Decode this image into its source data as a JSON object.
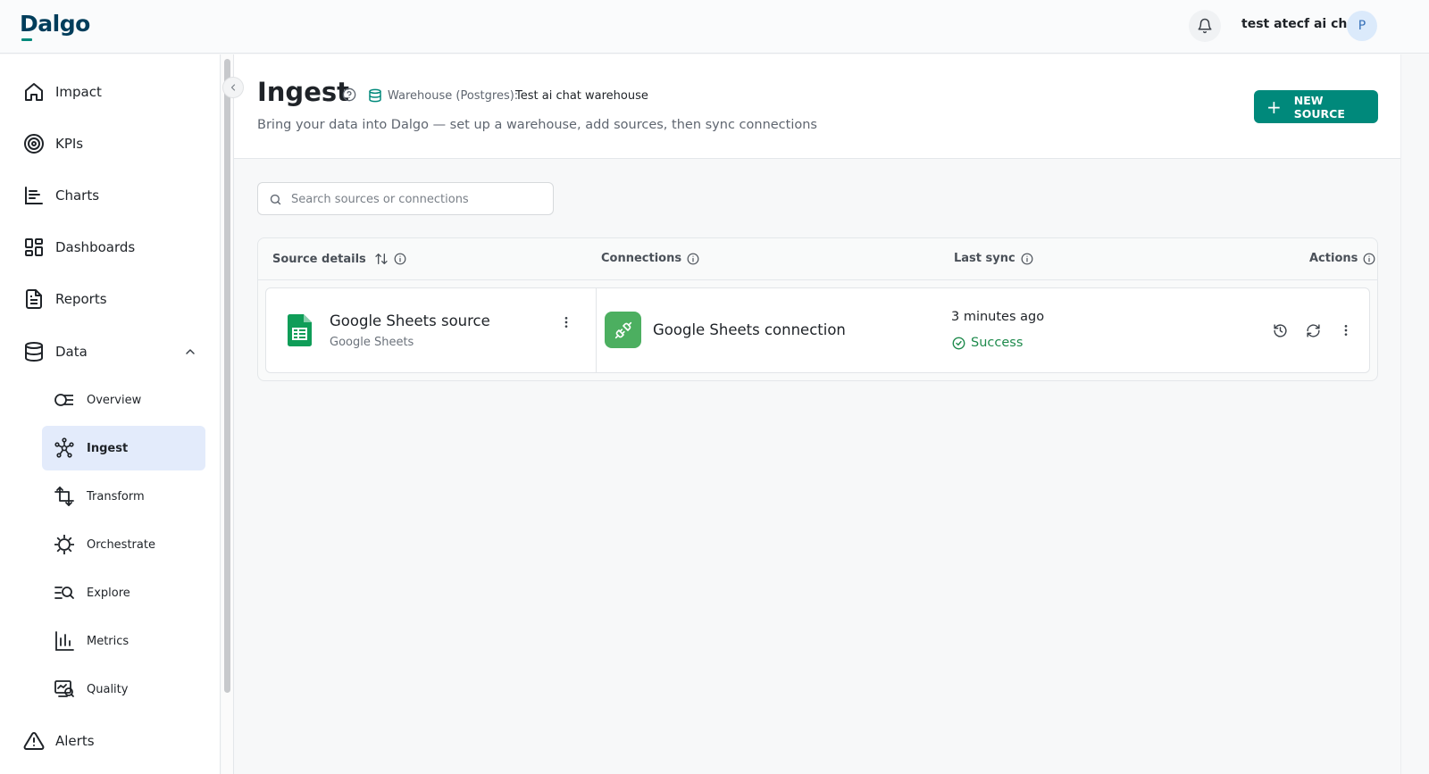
{
  "app": {
    "logo": "Dalgo"
  },
  "user": {
    "name": "test atecf ai chat",
    "avatar_initial": "P"
  },
  "sidebar": {
    "main_top": [
      {
        "label": "Impact",
        "icon": "home-icon"
      },
      {
        "label": "KPIs",
        "icon": "target-icon"
      },
      {
        "label": "Charts",
        "icon": "bar-chart-icon"
      },
      {
        "label": "Dashboards",
        "icon": "dashboard-grid-icon"
      },
      {
        "label": "Reports",
        "icon": "document-icon"
      },
      {
        "label": "Data",
        "icon": "database-icon",
        "expanded": true
      }
    ],
    "data_children": [
      {
        "label": "Overview",
        "icon": "overview-icon"
      },
      {
        "label": "Ingest",
        "icon": "ingest-network-icon",
        "active": true
      },
      {
        "label": "Transform",
        "icon": "transform-arrows-icon"
      },
      {
        "label": "Orchestrate",
        "icon": "orchestrate-gear-icon"
      },
      {
        "label": "Explore",
        "icon": "explore-search-icon"
      },
      {
        "label": "Metrics",
        "icon": "metrics-bars-icon"
      },
      {
        "label": "Quality",
        "icon": "quality-monitor-icon"
      }
    ],
    "main_bottom": [
      {
        "label": "Alerts",
        "icon": "alert-triangle-icon"
      }
    ]
  },
  "page": {
    "title": "Ingest",
    "warehouse_label": "Warehouse (Postgres):",
    "warehouse_name": "Test ai chat warehouse",
    "subtitle": "Bring your data into Dalgo — set up a warehouse, add sources, then sync connections",
    "new_source_label": "NEW SOURCE"
  },
  "search": {
    "placeholder": "Search sources or connections",
    "value": ""
  },
  "table": {
    "columns": [
      "Source details",
      "Connections",
      "Last sync",
      "Actions"
    ],
    "rows": [
      {
        "source_name": "Google Sheets source",
        "source_type": "Google Sheets",
        "connection_name": "Google Sheets connection",
        "last_sync": "3 minutes ago",
        "status": "Success"
      }
    ]
  },
  "colors": {
    "accent": "#00897b",
    "success": "#1e8a4c",
    "active_nav_bg": "#e3ebfb",
    "sheets_green": "#0f9d58",
    "connection_green": "#4caf60"
  }
}
